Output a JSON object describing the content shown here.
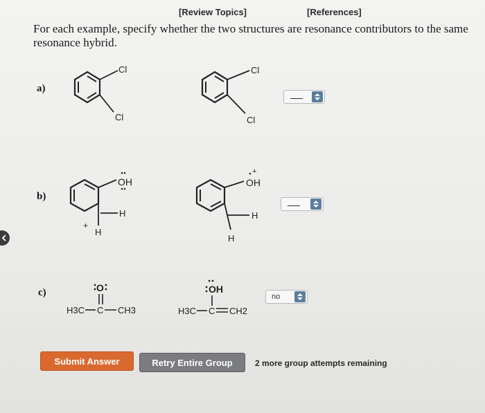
{
  "header": {
    "review_topics": "[Review Topics]",
    "references": "[References]"
  },
  "question": {
    "text": "For each example, specify whether the two structures are resonance contributors to the same resonance hybrid."
  },
  "examples": [
    {
      "label": "a)",
      "left": {
        "sub1": "Cl",
        "sub2": "Cl"
      },
      "right": {
        "sub1": "Cl",
        "sub2": "Cl"
      },
      "answer": {
        "selected": ""
      }
    },
    {
      "label": "b)",
      "left": {
        "oh": "OH",
        "h1": "H",
        "h2": "H",
        "charge": "+"
      },
      "right": {
        "oh": "OH",
        "h1": "H",
        "h2": "H",
        "charge": "+"
      },
      "answer": {
        "selected": ""
      }
    },
    {
      "label": "c)",
      "left": {
        "o": "O",
        "lc": "H3C",
        "c": "C",
        "rc": "CH3"
      },
      "right": {
        "oh": "OH",
        "lc": "H3C",
        "c": "C",
        "rc": "CH2"
      },
      "answer": {
        "selected": "no"
      }
    }
  ],
  "actions": {
    "submit_label": "Submit Answer",
    "retry_label": "Retry Entire Group",
    "attempts_text": "2 more group attempts remaining"
  },
  "colors": {
    "submit": "#d9692f",
    "retry": "#7a7c80",
    "select_arrow": "#5a7d9e"
  }
}
